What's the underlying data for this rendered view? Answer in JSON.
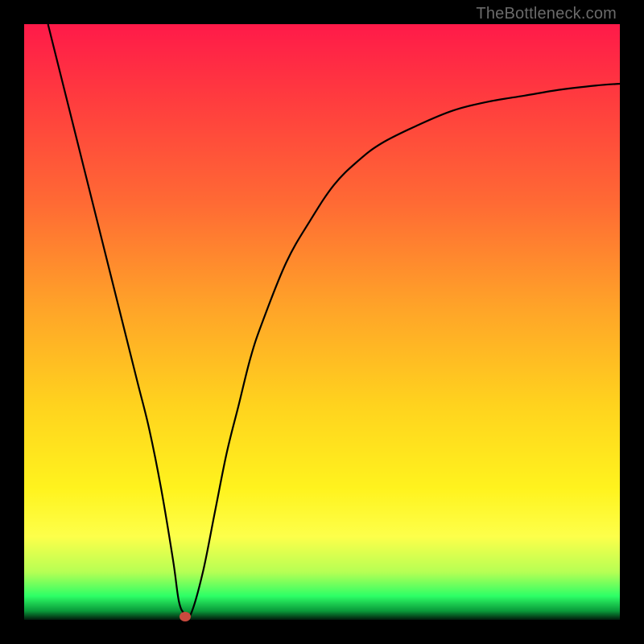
{
  "attribution": "TheBottleneck.com",
  "chart_data": {
    "type": "line",
    "title": "",
    "xlabel": "",
    "ylabel": "",
    "xlim": [
      0,
      100
    ],
    "ylim": [
      0,
      100
    ],
    "grid": false,
    "legend": false,
    "series": [
      {
        "name": "curve",
        "x": [
          4,
          7,
          10,
          13,
          16,
          19,
          21,
          23,
          25,
          26,
          27,
          28,
          30,
          32,
          34,
          36,
          38,
          40,
          44,
          48,
          52,
          56,
          60,
          66,
          72,
          78,
          84,
          90,
          96,
          100
        ],
        "y": [
          100,
          88,
          76,
          64,
          52,
          40,
          32,
          22,
          10,
          3,
          1,
          1,
          8,
          18,
          28,
          36,
          44,
          50,
          60,
          67,
          73,
          77,
          80,
          83,
          85.5,
          87,
          88,
          89,
          89.7,
          90
        ]
      }
    ],
    "marker": {
      "x": 27,
      "y": 0.5
    }
  },
  "colors": {
    "curve": "#000000",
    "marker": "#c94a3e"
  }
}
